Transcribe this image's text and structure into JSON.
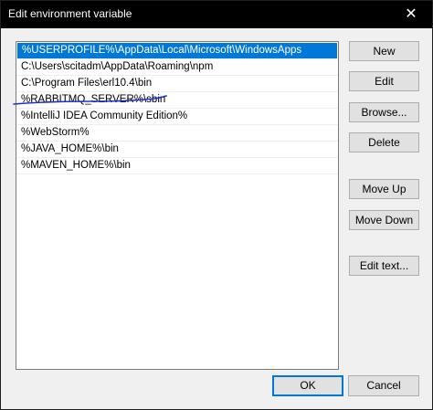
{
  "window": {
    "title": "Edit environment variable",
    "close_glyph": "✕"
  },
  "list": {
    "items": [
      "%USERPROFILE%\\AppData\\Local\\Microsoft\\WindowsApps",
      "C:\\Users\\scitadm\\AppData\\Roaming\\npm",
      "C:\\Program Files\\erl10.4\\bin",
      "%RABBITMQ_SERVER%\\sbin",
      "%IntelliJ IDEA Community Edition%",
      "%WebStorm%",
      "%JAVA_HOME%\\bin",
      "%MAVEN_HOME%\\bin"
    ],
    "selected_index": 0
  },
  "buttons": {
    "new": "New",
    "edit": "Edit",
    "browse": "Browse...",
    "delete": "Delete",
    "move_up": "Move Up",
    "move_down": "Move Down",
    "edit_text": "Edit text...",
    "ok": "OK",
    "cancel": "Cancel"
  },
  "colors": {
    "selection": "#0078d7",
    "titlebar": "#000000",
    "annotation_ink": "#1a2fd6"
  }
}
